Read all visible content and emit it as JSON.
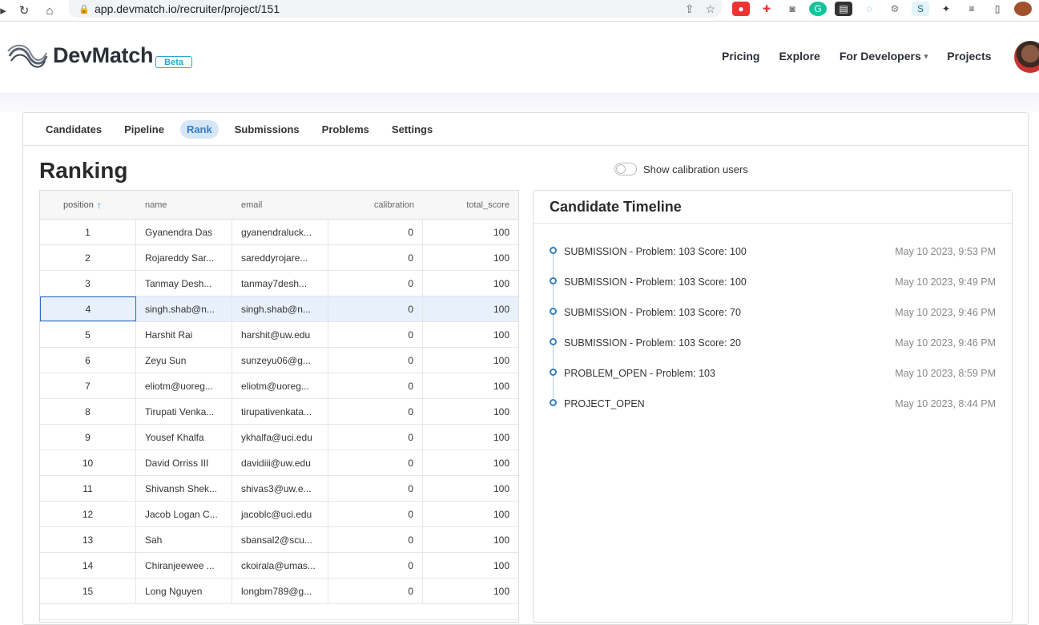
{
  "browser": {
    "url": "app.devmatch.io/recruiter/project/151"
  },
  "header": {
    "brand": "DevMatch",
    "badge": "Beta",
    "nav": [
      "Pricing",
      "Explore",
      "For Developers",
      "Projects"
    ]
  },
  "tabs": [
    "Candidates",
    "Pipeline",
    "Rank",
    "Submissions",
    "Problems",
    "Settings"
  ],
  "active_tab": "Rank",
  "page": {
    "title": "Ranking",
    "toggle_label": "Show calibration users"
  },
  "grid": {
    "columns": [
      "position",
      "name",
      "email",
      "calibration",
      "total_score"
    ],
    "rows": [
      [
        "1",
        "Gyanendra Das",
        "gyanendraluck...",
        "0",
        "100"
      ],
      [
        "2",
        "Rojareddy Sar...",
        "sareddyrojare...",
        "0",
        "100"
      ],
      [
        "3",
        "Tanmay Desh...",
        "tanmay7desh...",
        "0",
        "100"
      ],
      [
        "4",
        "singh.shab@n...",
        "singh.shab@n...",
        "0",
        "100"
      ],
      [
        "5",
        "Harshit Rai",
        "harshit@uw.edu",
        "0",
        "100"
      ],
      [
        "6",
        "Zeyu Sun",
        "sunzeyu06@g...",
        "0",
        "100"
      ],
      [
        "7",
        "eliotm@uoreg...",
        "eliotm@uoreg...",
        "0",
        "100"
      ],
      [
        "8",
        "Tirupati Venka...",
        "tirupativenkata...",
        "0",
        "100"
      ],
      [
        "9",
        "Yousef Khalfa",
        "ykhalfa@uci.edu",
        "0",
        "100"
      ],
      [
        "10",
        "David Orriss III",
        "davidiii@uw.edu",
        "0",
        "100"
      ],
      [
        "11",
        "Shivansh Shek...",
        "shivas3@uw.e...",
        "0",
        "100"
      ],
      [
        "12",
        "Jacob Logan C...",
        "jacoblc@uci.edu",
        "0",
        "100"
      ],
      [
        "13",
        "Sah",
        "sbansal2@scu...",
        "0",
        "100"
      ],
      [
        "14",
        "Chiranjeewee ...",
        "ckoirala@umas...",
        "0",
        "100"
      ],
      [
        "15",
        "Long Nguyen",
        "longbm789@g...",
        "0",
        "100"
      ]
    ]
  },
  "timeline": {
    "title": "Candidate Timeline",
    "events": [
      {
        "text": "SUBMISSION - Problem: 103 Score: 100",
        "date": "May 10 2023, 9:53 PM"
      },
      {
        "text": "SUBMISSION - Problem: 103 Score: 100",
        "date": "May 10 2023, 9:49 PM"
      },
      {
        "text": "SUBMISSION - Problem: 103 Score: 70",
        "date": "May 10 2023, 9:46 PM"
      },
      {
        "text": "SUBMISSION - Problem: 103 Score: 20",
        "date": "May 10 2023, 9:46 PM"
      },
      {
        "text": "PROBLEM_OPEN - Problem: 103",
        "date": "May 10 2023, 8:59 PM"
      },
      {
        "text": "PROJECT_OPEN",
        "date": "May 10 2023, 8:44 PM"
      }
    ]
  }
}
